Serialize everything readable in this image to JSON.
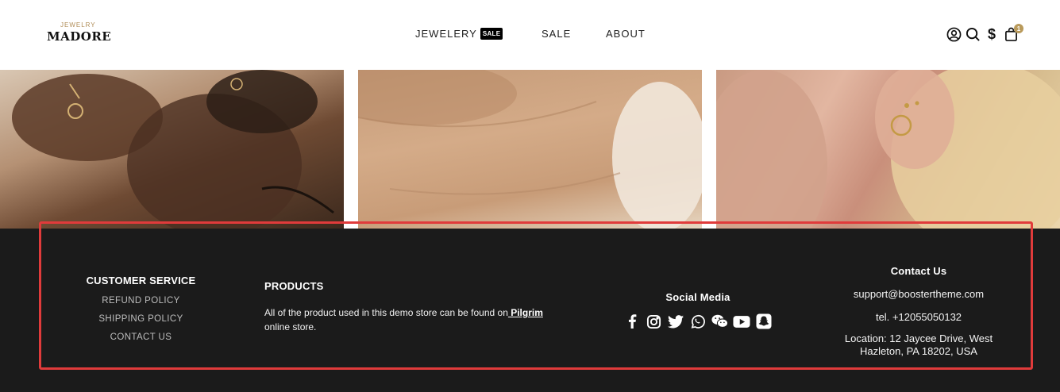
{
  "header": {
    "logo_small": "JEWELRY",
    "logo_main": "MADORE",
    "nav": [
      {
        "label": "JEWELERY",
        "badge": "SALE"
      },
      {
        "label": "SALE"
      },
      {
        "label": "ABOUT"
      }
    ],
    "icons": [
      "account-icon",
      "search-icon",
      "currency-icon",
      "cart-icon"
    ],
    "cart_count": "1",
    "currency_symbol": "$"
  },
  "footer": {
    "customer_service": {
      "title": "CUSTOMER SERVICE",
      "links": [
        "REFUND POLICY",
        "SHIPPING POLICY",
        "CONTACT US"
      ]
    },
    "products": {
      "title": "PRODUCTS",
      "text_before": "All of the product used in this demo store can be found on",
      "link": " Pilgrim",
      "text_after": " online store."
    },
    "social": {
      "title": "Social Media",
      "icons": [
        "facebook-icon",
        "instagram-icon",
        "twitter-icon",
        "whatsapp-icon",
        "wechat-icon",
        "youtube-icon",
        "snapchat-icon"
      ]
    },
    "contact": {
      "title": "Contact Us",
      "email": "support@boostertheme.com",
      "phone": "tel. +12055050132",
      "location": "Location: 12 Jaycee Drive, West Hazleton, PA 18202, USA"
    }
  },
  "colors": {
    "footer_bg": "#1b1b1b",
    "accent_gold": "#b99a5b",
    "highlight_border": "#e03b3b"
  }
}
